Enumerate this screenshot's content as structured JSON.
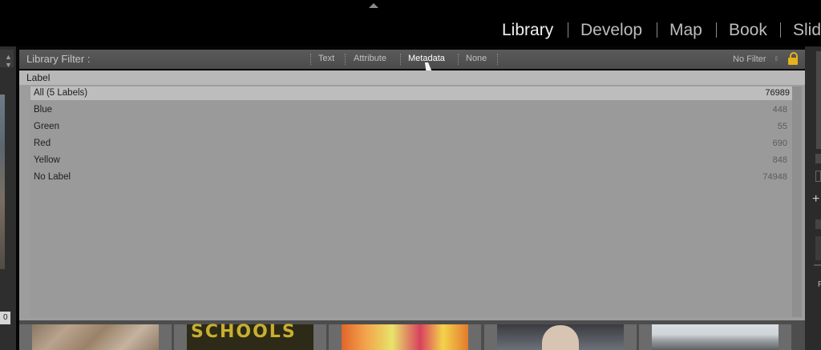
{
  "modules": [
    {
      "label": "Library",
      "active": true
    },
    {
      "label": "Develop",
      "active": false
    },
    {
      "label": "Map",
      "active": false
    },
    {
      "label": "Book",
      "active": false
    },
    {
      "label": "Slid",
      "active": false
    }
  ],
  "module_separator": "|",
  "filter_bar": {
    "title": "Library Filter :",
    "tabs": [
      {
        "label": "Text",
        "active": false
      },
      {
        "label": "Attribute",
        "active": false
      },
      {
        "label": "Metadata",
        "active": true
      },
      {
        "label": "None",
        "active": false
      }
    ],
    "preset": "No Filter",
    "lock_icon": "lock-icon",
    "lock_color": "#e4b21c"
  },
  "label_column": {
    "header": "Label",
    "rows": [
      {
        "label": "All (5 Labels)",
        "count": "76989",
        "selected": true
      },
      {
        "label": "Blue",
        "count": "448",
        "selected": false
      },
      {
        "label": "Green",
        "count": "55",
        "selected": false
      },
      {
        "label": "Red",
        "count": "690",
        "selected": false
      },
      {
        "label": "Yellow",
        "count": "848",
        "selected": false
      },
      {
        "label": "No Label",
        "count": "74948",
        "selected": false
      }
    ]
  },
  "filmstrip": {
    "sign_text": "SCHOOLS"
  },
  "side_panels": {
    "left_readout": "0",
    "right_plus": "+",
    "right_text": "F"
  }
}
